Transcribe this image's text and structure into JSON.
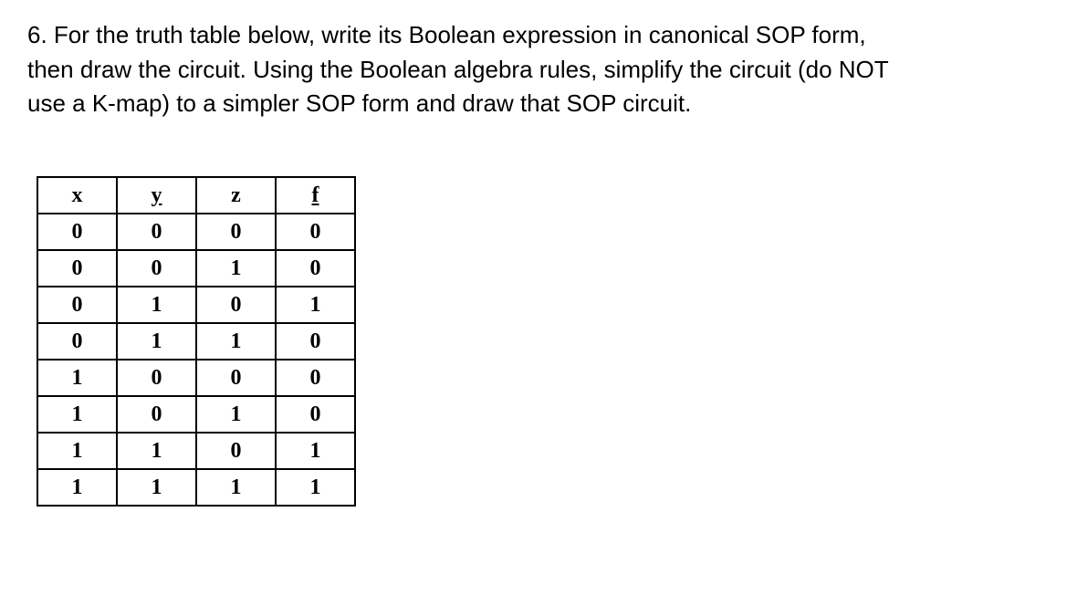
{
  "question": {
    "number": "6.",
    "text_line1": "6. For the truth table below, write its Boolean expression in canonical SOP form,",
    "text_line2": "then draw the circuit. Using the Boolean algebra rules, simplify the circuit (do NOT",
    "text_line3": "use a K-map) to a simpler SOP form and draw that SOP circuit."
  },
  "table": {
    "headers": [
      "x",
      "y",
      "z",
      "f"
    ],
    "rows": [
      [
        "0",
        "0",
        "0",
        "0"
      ],
      [
        "0",
        "0",
        "1",
        "0"
      ],
      [
        "0",
        "1",
        "0",
        "1"
      ],
      [
        "0",
        "1",
        "1",
        "0"
      ],
      [
        "1",
        "0",
        "0",
        "0"
      ],
      [
        "1",
        "0",
        "1",
        "0"
      ],
      [
        "1",
        "1",
        "0",
        "1"
      ],
      [
        "1",
        "1",
        "1",
        "1"
      ]
    ]
  },
  "chart_data": {
    "type": "table",
    "title": "Truth table for f(x,y,z)",
    "columns": [
      "x",
      "y",
      "z",
      "f"
    ],
    "data": [
      {
        "x": 0,
        "y": 0,
        "z": 0,
        "f": 0
      },
      {
        "x": 0,
        "y": 0,
        "z": 1,
        "f": 0
      },
      {
        "x": 0,
        "y": 1,
        "z": 0,
        "f": 1
      },
      {
        "x": 0,
        "y": 1,
        "z": 1,
        "f": 0
      },
      {
        "x": 1,
        "y": 0,
        "z": 0,
        "f": 0
      },
      {
        "x": 1,
        "y": 0,
        "z": 1,
        "f": 0
      },
      {
        "x": 1,
        "y": 1,
        "z": 0,
        "f": 1
      },
      {
        "x": 1,
        "y": 1,
        "z": 1,
        "f": 1
      }
    ]
  }
}
